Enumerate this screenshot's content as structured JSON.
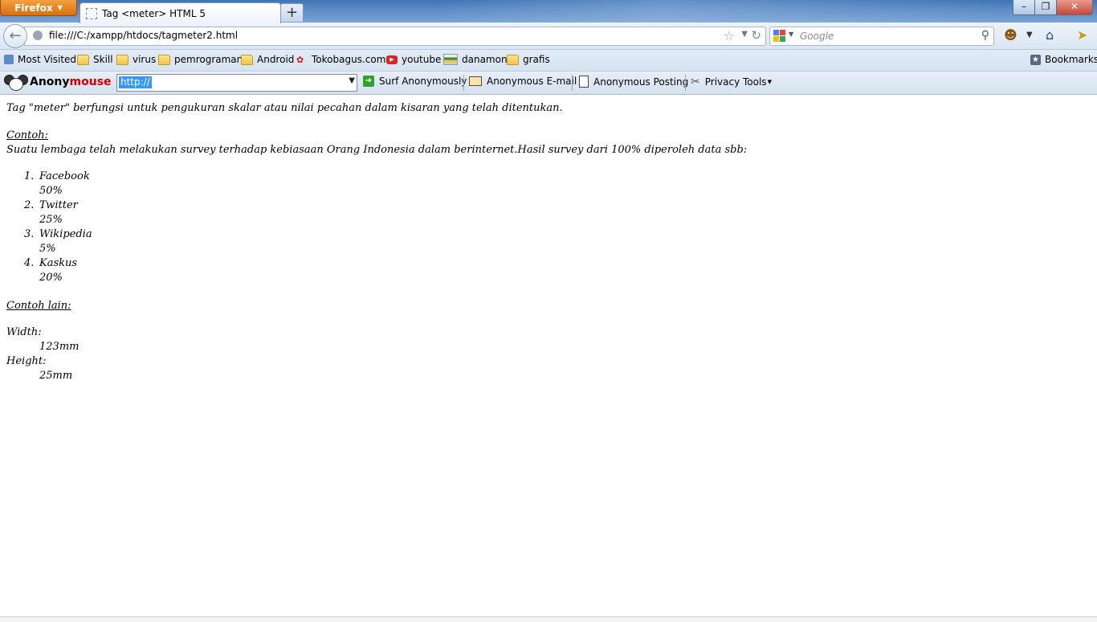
{
  "browser": {
    "menu_label": "Firefox",
    "tab_title": "Tag <meter> HTML 5",
    "url": "file:///C:/xampp/htdocs/tagmeter2.html",
    "search_placeholder": "Google"
  },
  "bookmarks": {
    "items": [
      {
        "label": "Most Visited",
        "icon": "most-visited-icon"
      },
      {
        "label": "Skill",
        "icon": "folder-icon"
      },
      {
        "label": "virus",
        "icon": "folder-icon"
      },
      {
        "label": "pemrograman",
        "icon": "folder-icon"
      },
      {
        "label": "Android",
        "icon": "folder-icon"
      },
      {
        "label": "Tokobagus.com",
        "icon": "tokobagus-icon"
      },
      {
        "label": "youtube",
        "icon": "youtube-icon"
      },
      {
        "label": "danamon",
        "icon": "danamon-icon"
      },
      {
        "label": "grafis",
        "icon": "folder-icon"
      }
    ],
    "bookmarks_menu": "Bookmarks"
  },
  "anonymouse": {
    "logo_part1": "Anony",
    "logo_part2": "mouse",
    "combo_value": "http://",
    "surf": "Surf Anonymously",
    "email": "Anonymous E-mail",
    "posting": "Anonymous Posting",
    "privacy": "Privacy Tools"
  },
  "page": {
    "intro": "Tag \"meter\" berfungsi untuk pengukuran skalar atau nilai pecahan dalam kisaran yang telah ditentukan.",
    "contoh_title": "Contoh:",
    "survey_text": "Suatu lembaga telah melakukan survey terhadap kebiasaan Orang Indonesia dalam berinternet.Hasil survey dari 100% diperoleh data sbb:",
    "list": [
      {
        "num": "1.",
        "name": "Facebook",
        "value": "50%"
      },
      {
        "num": "2.",
        "name": "Twitter",
        "value": "25%"
      },
      {
        "num": "3.",
        "name": "Wikipedia",
        "value": "5%"
      },
      {
        "num": "4.",
        "name": "Kaskus",
        "value": "20%"
      }
    ],
    "lain_title": "Contoh lain:",
    "width_label": "Width:",
    "width_value": "123mm",
    "height_label": "Height:",
    "height_value": "25mm"
  },
  "colors": {
    "titlebar": "#5c8ac4",
    "firefox_button": "#e8861f",
    "selection": "#3399ff",
    "anonymouse_red": "#d40000"
  }
}
